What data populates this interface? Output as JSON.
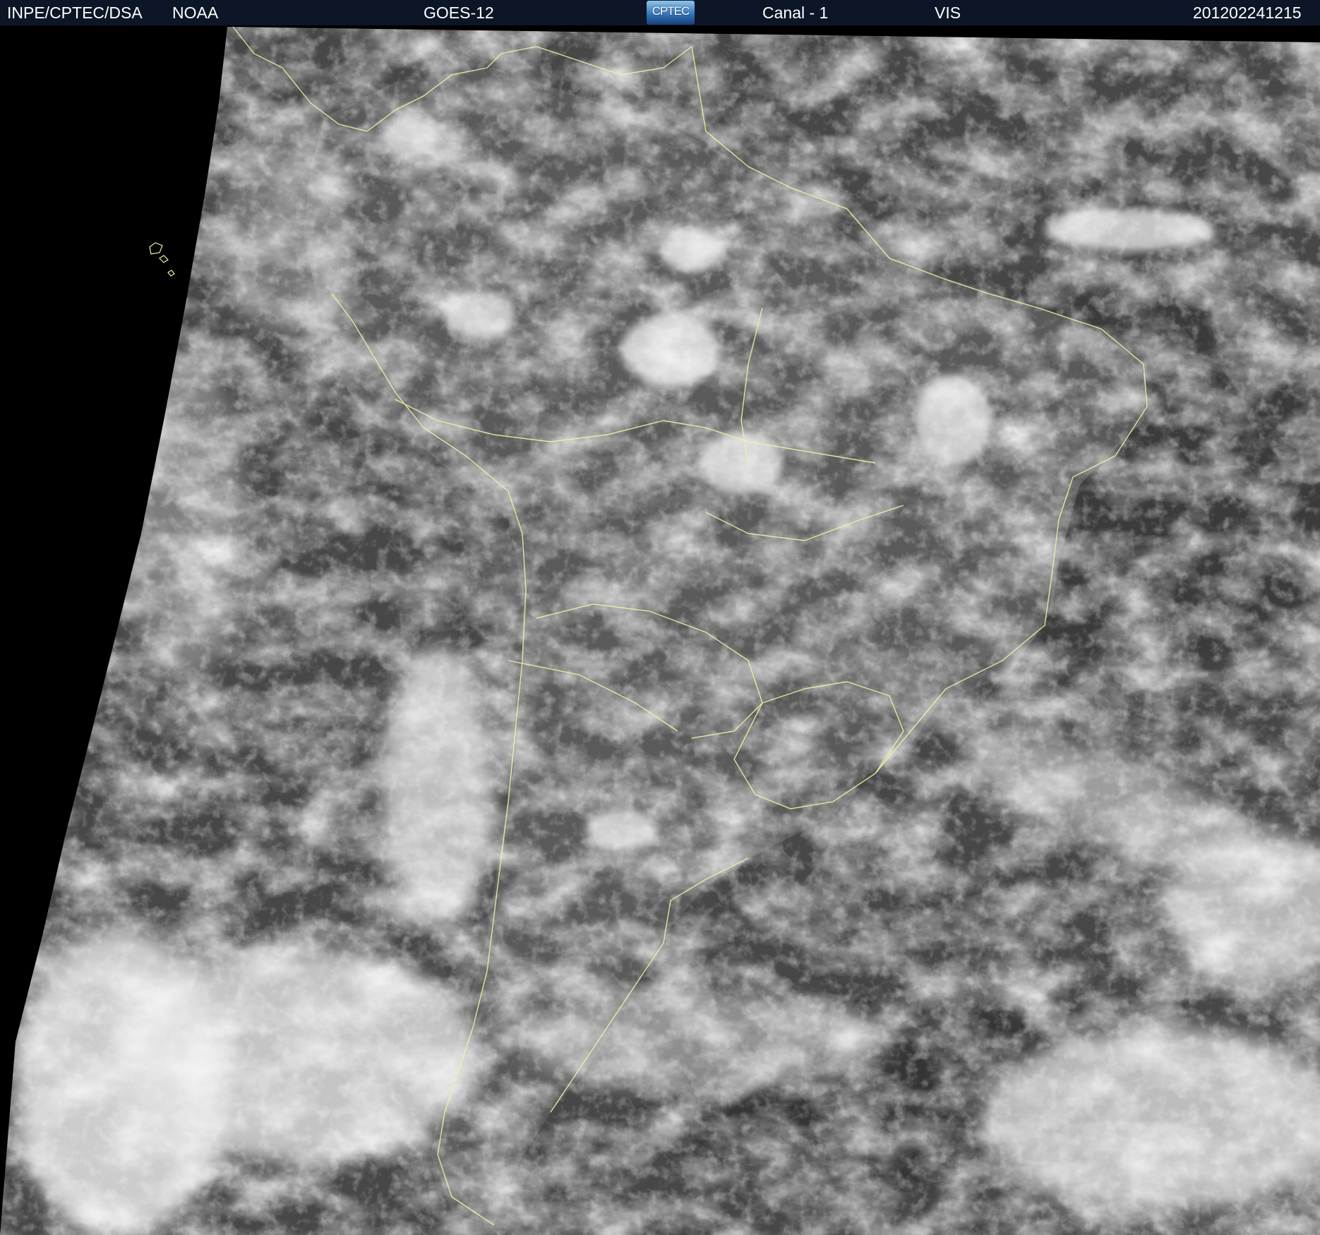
{
  "header": {
    "agency": "INPE/CPTEC/DSA",
    "provider": "NOAA",
    "satellite": "GOES-12",
    "logo_text": "CPTEC",
    "channel": "Canal - 1",
    "band": "VIS",
    "timestamp": "201202241215"
  },
  "colors": {
    "header_bg": "#0c1626",
    "header_text": "#ffffff",
    "space": "#000000",
    "ocean": "#4a4a4a",
    "cloud": "#e8e8e8",
    "border_lines": "#f2f0a8"
  }
}
